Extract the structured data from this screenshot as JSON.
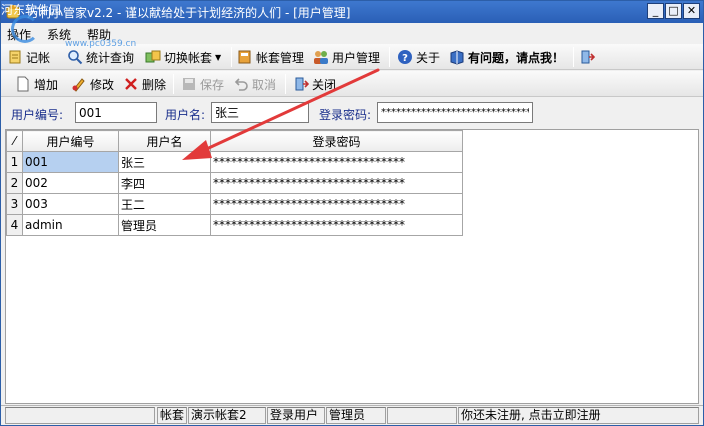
{
  "window": {
    "title": "万利小管家v2.2 - 谨以献给处于计划经济的人们 - [用户管理]",
    "watermark": "河东软件园",
    "watermark_url": "www.pc0359.cn",
    "controls": {
      "minimize": "_",
      "maximize": "□",
      "close": "✕"
    }
  },
  "menu": {
    "items": [
      "操作",
      "系统",
      "帮助"
    ]
  },
  "toolbar_main": {
    "items": [
      {
        "label": "记帐",
        "icon": "ledger-icon"
      },
      {
        "label": "统计查询",
        "icon": "magnifier-icon"
      },
      {
        "label": "切换帐套",
        "icon": "switch-icon"
      },
      {
        "label": "帐套管理",
        "icon": "account-book-icon"
      },
      {
        "label": "用户管理",
        "icon": "users-icon"
      },
      {
        "label": "关于",
        "icon": "help-icon"
      },
      {
        "label": "有问题，请点我！",
        "icon": "book-icon"
      },
      {
        "label": "",
        "icon": "exit-door-icon"
      }
    ]
  },
  "toolbar_edit": {
    "items": [
      {
        "label": "增加",
        "icon": "new-page-icon",
        "enabled": true
      },
      {
        "label": "修改",
        "icon": "pencil-icon",
        "enabled": true
      },
      {
        "label": "删除",
        "icon": "red-x-icon",
        "enabled": true
      },
      {
        "label": "保存",
        "icon": "disk-icon",
        "enabled": false
      },
      {
        "label": "取消",
        "icon": "undo-icon",
        "enabled": false
      },
      {
        "label": "关闭",
        "icon": "exit-door-icon",
        "enabled": true
      }
    ]
  },
  "filter": {
    "user_id_label": "用户编号:",
    "user_id_value": "001",
    "user_name_label": "用户名:",
    "user_name_value": "张三",
    "password_label": "登录密码:",
    "password_value": "********************************"
  },
  "grid": {
    "indicator": "⁄",
    "columns": [
      "用户编号",
      "用户名",
      "登录密码"
    ],
    "rows": [
      {
        "num": "1",
        "id": "001",
        "name": "张三",
        "password": "********************************"
      },
      {
        "num": "2",
        "id": "002",
        "name": "李四",
        "password": "********************************"
      },
      {
        "num": "3",
        "id": "003",
        "name": "王二",
        "password": "********************************"
      },
      {
        "num": "4",
        "id": "admin",
        "name": "管理员",
        "password": "********************************"
      }
    ]
  },
  "statusbar": {
    "account_label": "帐套",
    "account_value": "演示帐套2",
    "user_label": "登录用户",
    "user_value": "管理员",
    "register": "你还未注册, 点击立即注册"
  },
  "colors": {
    "accent": "#2a5fb6",
    "label_blue": "#1a2f8c",
    "arrow_red": "#e23a3a",
    "selected": "#b6d0f0"
  }
}
